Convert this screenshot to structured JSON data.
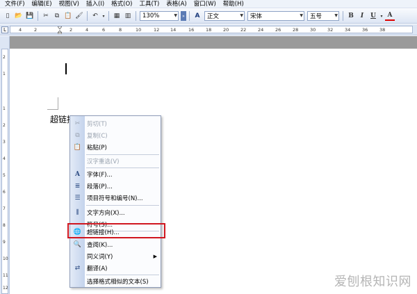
{
  "menubar": {
    "items": [
      "文件(F)",
      "编辑(E)",
      "视图(V)",
      "插入(I)",
      "格式(O)",
      "工具(T)",
      "表格(A)",
      "窗口(W)",
      "帮助(H)"
    ]
  },
  "toolbar": {
    "zoom": "130%",
    "style": "正文",
    "font": "宋体",
    "size": "五号",
    "bold": "B",
    "italic": "I",
    "underline": "U",
    "font_color": "A"
  },
  "ruler": {
    "ticks": [
      "4",
      "2",
      "2",
      "4",
      "6",
      "8",
      "10",
      "12",
      "14",
      "16",
      "18",
      "20",
      "22",
      "24",
      "26",
      "28",
      "30",
      "32",
      "34",
      "36",
      "38"
    ],
    "vticks": [
      "2",
      "1",
      "1",
      "2",
      "3",
      "4",
      "5",
      "6",
      "7",
      "8",
      "9",
      "10",
      "11",
      "12"
    ]
  },
  "document": {
    "text": "超链接"
  },
  "context_menu": {
    "items": [
      {
        "label": "剪切(T)",
        "icon": "scissors-icon",
        "disabled": true
      },
      {
        "label": "复制(C)",
        "icon": "copy-icon",
        "disabled": true
      },
      {
        "label": "粘贴(P)",
        "icon": "paste-icon",
        "disabled": false
      },
      {
        "label": "汉字重选(V)",
        "icon": "",
        "disabled": true
      },
      {
        "label": "字体(F)...",
        "icon": "font-icon",
        "disabled": false
      },
      {
        "label": "段落(P)...",
        "icon": "paragraph-icon",
        "disabled": false
      },
      {
        "label": "项目符号和编号(N)...",
        "icon": "bullets-icon",
        "disabled": false
      },
      {
        "label": "文字方向(X)...",
        "icon": "text-direction-icon",
        "disabled": false
      },
      {
        "label": "符号(S)...",
        "icon": "",
        "disabled": false
      },
      {
        "label": "超链接(H)...",
        "icon": "hyperlink-icon",
        "disabled": false
      },
      {
        "label": "查阅(K)...",
        "icon": "research-icon",
        "disabled": false
      },
      {
        "label": "同义词(Y)",
        "icon": "",
        "disabled": false,
        "submenu": true
      },
      {
        "label": "翻译(A)",
        "icon": "translate-icon",
        "disabled": false
      },
      {
        "label": "选择格式相似的文本(S)",
        "icon": "",
        "disabled": false
      }
    ]
  },
  "watermark": "爱刨根知识网",
  "colors": {
    "highlight": "#d0161f",
    "toolbar_bg": "#dde6f4"
  }
}
